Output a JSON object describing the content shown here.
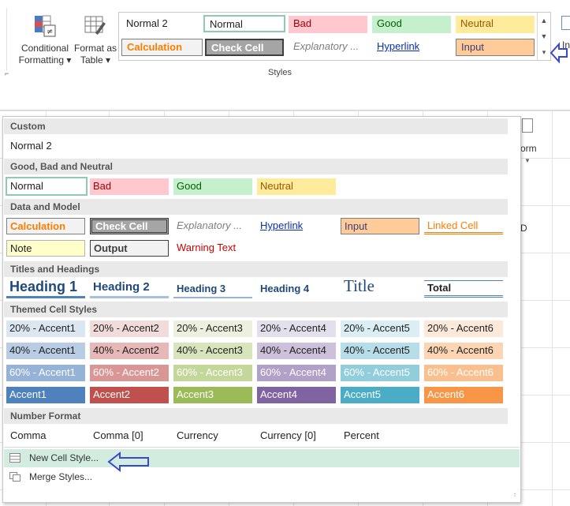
{
  "ribbon": {
    "conditional_formatting": [
      "Conditional",
      "Formatting ▾"
    ],
    "format_as_table": [
      "Format as",
      "Table ▾"
    ],
    "group_label": "Styles",
    "gallery": [
      {
        "label": "Normal 2"
      },
      {
        "label": "Normal"
      },
      {
        "label": "Bad"
      },
      {
        "label": "Good"
      },
      {
        "label": "Neutral"
      },
      {
        "label": "Calculation"
      },
      {
        "label": "Check Cell"
      },
      {
        "label": "Explanatory ..."
      },
      {
        "label": "Hyperlink"
      },
      {
        "label": "Input"
      }
    ],
    "right_fragment": "In"
  },
  "sheet": {
    "right_fragment_1": "orm",
    "right_fragment_2": "D"
  },
  "panel": {
    "sections": {
      "custom": "Custom",
      "good_bad": "Good, Bad and Neutral",
      "data_model": "Data and Model",
      "titles": "Titles and Headings",
      "themed": "Themed Cell Styles",
      "number": "Number Format"
    },
    "custom": [
      "Normal 2"
    ],
    "good_bad": [
      "Normal",
      "Bad",
      "Good",
      "Neutral"
    ],
    "data_model_row1": [
      "Calculation",
      "Check Cell",
      "Explanatory ...",
      "Hyperlink",
      "Input",
      "Linked Cell"
    ],
    "data_model_row2": [
      "Note",
      "Output",
      "Warning Text"
    ],
    "titles": [
      "Heading 1",
      "Heading 2",
      "Heading 3",
      "Heading 4",
      "Title",
      "Total"
    ],
    "themed": {
      "row20": [
        "20% - Accent1",
        "20% - Accent2",
        "20% - Accent3",
        "20% - Accent4",
        "20% - Accent5",
        "20% - Accent6"
      ],
      "row40": [
        "40% - Accent1",
        "40% - Accent2",
        "40% - Accent3",
        "40% - Accent4",
        "40% - Accent5",
        "40% - Accent6"
      ],
      "row60": [
        "60% - Accent1",
        "60% - Accent2",
        "60% - Accent3",
        "60% - Accent4",
        "60% - Accent5",
        "60% - Accent6"
      ],
      "row100": [
        "Accent1",
        "Accent2",
        "Accent3",
        "Accent4",
        "Accent5",
        "Accent6"
      ]
    },
    "number": [
      "Comma",
      "Comma [0]",
      "Currency",
      "Currency [0]",
      "Percent"
    ],
    "menu": {
      "new_cell_style": "New Cell Style...",
      "merge_styles": "Merge Styles..."
    }
  },
  "colors": {
    "accent_highlight": "#d2ece0",
    "arrow": "#3a49c9",
    "bad_bg": "#ffc7ce",
    "bad_fg": "#9c0006",
    "good_bg": "#c6efce",
    "good_fg": "#006100",
    "neutral_bg": "#ffeb9c",
    "neutral_fg": "#9c5700"
  }
}
